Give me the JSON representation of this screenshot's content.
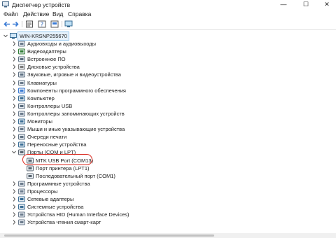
{
  "window": {
    "title": "Диспетчер устройств",
    "controls": {
      "minimize": "—",
      "maximize": "☐",
      "close": "✕"
    }
  },
  "menu": [
    "Файл",
    "Действие",
    "Вид",
    "Справка"
  ],
  "toolbar": {
    "icons": [
      "back-icon",
      "forward-icon",
      "properties-icon",
      "help-icon",
      "view-icon",
      "monitor-icon"
    ]
  },
  "tree": {
    "root": {
      "label": "WIN-KRSNP255670",
      "icon": "computer-icon"
    },
    "items": [
      {
        "label": "Аудиовходы и аудиовыходы",
        "icon": "speaker-icon",
        "expanded": false
      },
      {
        "label": "Видеоадаптеры",
        "icon": "display-adapter-icon",
        "expanded": false
      },
      {
        "label": "Встроенное ПО",
        "icon": "firmware-icon",
        "expanded": false
      },
      {
        "label": "Дисковые устройства",
        "icon": "disk-icon",
        "expanded": false
      },
      {
        "label": "Звуковые, игровые и видеоустройства",
        "icon": "sound-icon",
        "expanded": false
      },
      {
        "label": "Клавиатуры",
        "icon": "keyboard-icon",
        "expanded": false
      },
      {
        "label": "Компоненты программного обеспечения",
        "icon": "software-component-icon",
        "expanded": false
      },
      {
        "label": "Компьютер",
        "icon": "computer-icon",
        "expanded": false
      },
      {
        "label": "Контроллеры USB",
        "icon": "usb-icon",
        "expanded": false
      },
      {
        "label": "Контроллеры запоминающих устройств",
        "icon": "storage-controller-icon",
        "expanded": false
      },
      {
        "label": "Мониторы",
        "icon": "monitor-icon",
        "expanded": false
      },
      {
        "label": "Мыши и иные указывающие устройства",
        "icon": "mouse-icon",
        "expanded": false
      },
      {
        "label": "Очереди печати",
        "icon": "printer-icon",
        "expanded": false
      },
      {
        "label": "Переносные устройства",
        "icon": "portable-device-icon",
        "expanded": false
      },
      {
        "label": "Порты (COM и LPT)",
        "icon": "port-icon",
        "expanded": true,
        "children": [
          {
            "label": "MTK USB Port (COM13)",
            "icon": "port-icon",
            "highlighted": true
          },
          {
            "label": "Порт принтера (LPT1)",
            "icon": "port-icon"
          },
          {
            "label": "Последовательный порт (COM1)",
            "icon": "port-icon"
          }
        ]
      },
      {
        "label": "Программные устройства",
        "icon": "software-device-icon",
        "expanded": false
      },
      {
        "label": "Процессоры",
        "icon": "cpu-icon",
        "expanded": false
      },
      {
        "label": "Сетевые адаптеры",
        "icon": "network-icon",
        "expanded": false
      },
      {
        "label": "Системные устройства",
        "icon": "system-icon",
        "expanded": false
      },
      {
        "label": "Устройства HID (Human Interface Devices)",
        "icon": "hid-icon",
        "expanded": false
      },
      {
        "label": "Устройства чтения смарт-карт",
        "icon": "smartcard-icon",
        "expanded": false
      }
    ]
  },
  "colors": {
    "accent": "#1e88e5",
    "highlight_ring": "#d9261c",
    "selection": "#e5f1fb"
  }
}
